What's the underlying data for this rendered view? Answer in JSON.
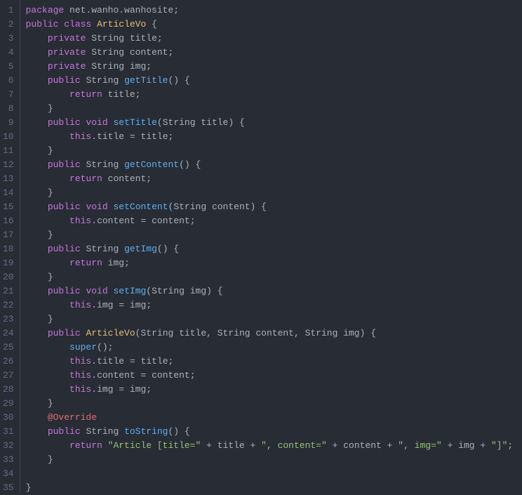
{
  "lineCount": 35,
  "tokens": {
    "package": "package",
    "public": "public",
    "private": "private",
    "class": "class",
    "void": "void",
    "return": "return",
    "this": "this",
    "super": "super",
    "String": "String",
    "ArticleVo": "ArticleVo",
    "title": "title",
    "content": "content",
    "img": "img",
    "getTitle": "getTitle",
    "setTitle": "setTitle",
    "getContent": "getContent",
    "setContent": "setContent",
    "getImg": "getImg",
    "setImg": "setImg",
    "toString": "toString",
    "Override": "@Override",
    "pkg": "net.wanho.wanhosite;",
    "str1": "\"Article [title=\"",
    "str2": "\", content=\"",
    "str3": "\", img=\"",
    "str4": "\"]\""
  }
}
